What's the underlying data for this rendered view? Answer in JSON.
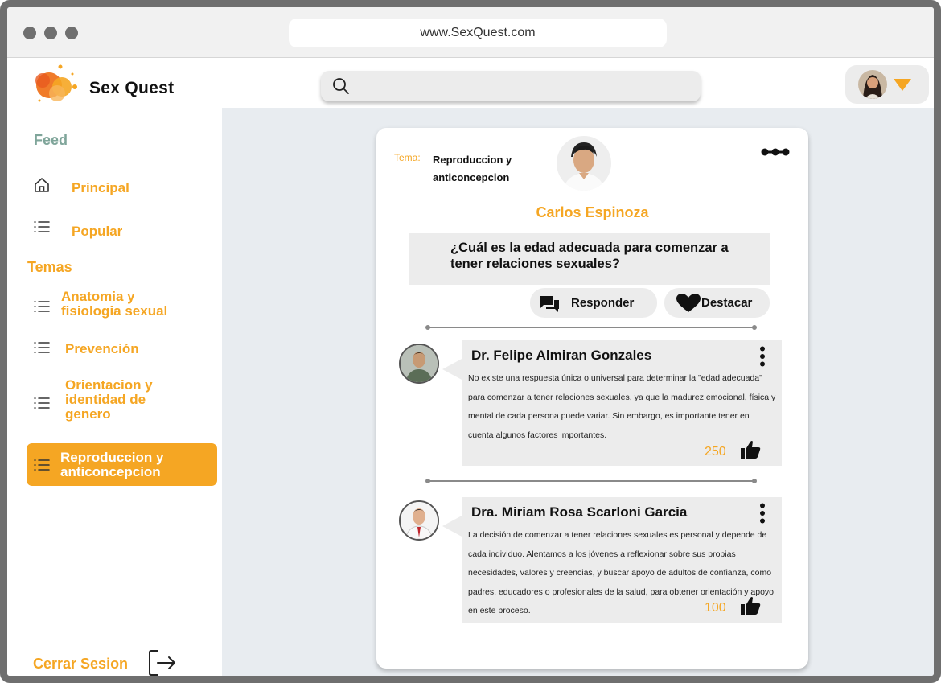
{
  "browser": {
    "url": "www.SexQuest.com"
  },
  "app": {
    "name": "Sex Quest",
    "accent_color": "#f5a623",
    "search": {
      "placeholder": ""
    }
  },
  "sidebar": {
    "feed_title": "Feed",
    "feed_items": [
      {
        "label": "Principal",
        "icon": "home-icon"
      },
      {
        "label": "Popular",
        "icon": "list-icon"
      }
    ],
    "temas_title": "Temas",
    "temas_items": [
      {
        "label": "Anatomia y fisiologia sexual",
        "icon": "list-icon",
        "active": false
      },
      {
        "label": "Prevención",
        "icon": "list-icon",
        "active": false
      },
      {
        "label": "Orientacion y identidad de genero",
        "icon": "list-icon",
        "active": false
      },
      {
        "label": "Reproduccion y anticoncepcion",
        "icon": "list-icon",
        "active": true
      }
    ],
    "logout_label": "Cerrar Sesion"
  },
  "post": {
    "tema_label": "Tema:",
    "tema_value": "Reproduccion y anticoncepcion",
    "author": "Carlos Espinoza",
    "question": "¿Cuál es la edad adecuada para comenzar a tener relaciones sexuales?",
    "actions": {
      "reply": "Responder",
      "highlight": "Destacar"
    },
    "answers": [
      {
        "name": "Dr. Felipe Almiran Gonzales",
        "text": "No existe una respuesta única o universal para determinar la \"edad adecuada\" para comenzar a tener relaciones sexuales, ya que la madurez emocional, física y mental de cada persona puede variar. Sin embargo, es importante tener en cuenta algunos factores importantes.",
        "votes": "250"
      },
      {
        "name": "Dra. Miriam Rosa Scarloni Garcia",
        "text": "La decisión de comenzar a tener relaciones sexuales es personal y depende de cada individuo. Alentamos a los jóvenes a reflexionar sobre sus propias necesidades, valores y creencias, y buscar apoyo de adultos de confianza, como padres, educadores o profesionales de la salud, para obtener orientación y apoyo en este proceso.",
        "votes": "100"
      }
    ]
  }
}
